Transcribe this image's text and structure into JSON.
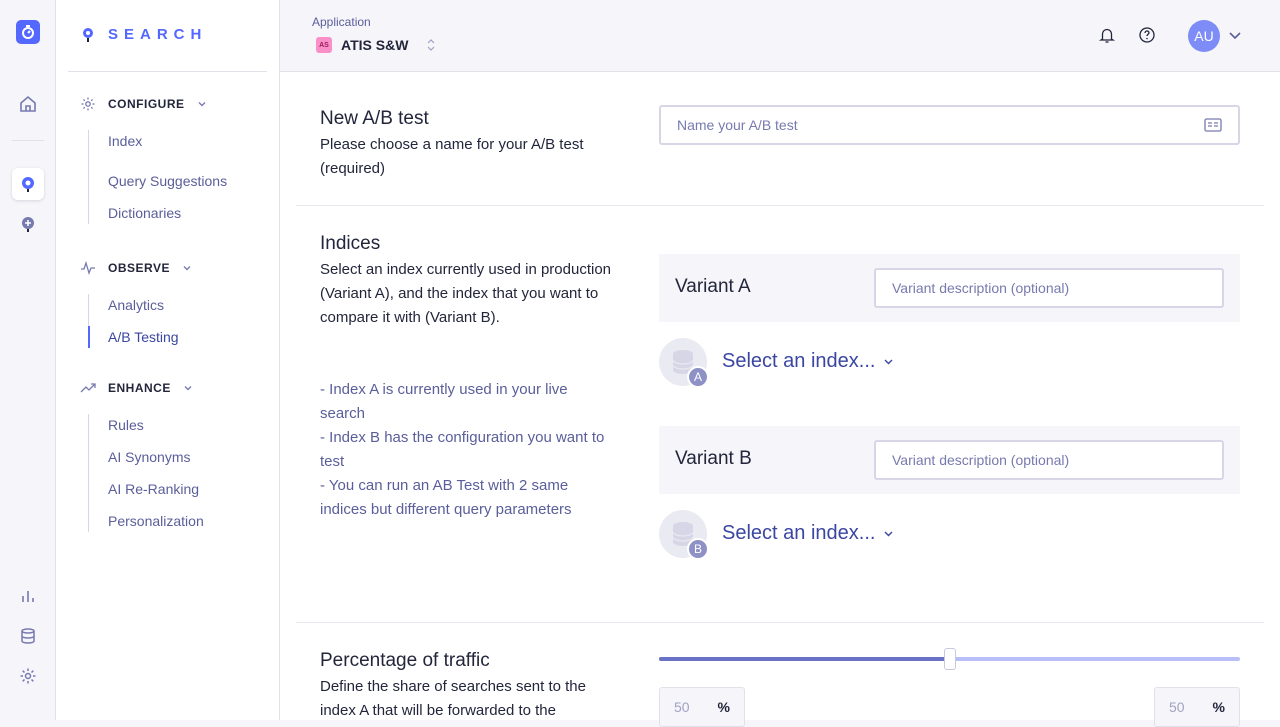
{
  "rail": {
    "items": [
      {
        "name": "algolia-logo-icon"
      },
      {
        "name": "home-icon"
      },
      {
        "name": "search-product-icon"
      },
      {
        "name": "recommend-product-icon"
      },
      {
        "name": "analytics-bars-icon"
      },
      {
        "name": "database-icon"
      },
      {
        "name": "settings-gear-icon"
      }
    ]
  },
  "sidebar": {
    "brand": "SEARCH",
    "sections": [
      {
        "label": "CONFIGURE",
        "items": [
          "Index",
          "Query Suggestions",
          "Dictionaries"
        ]
      },
      {
        "label": "OBSERVE",
        "items": [
          "Analytics",
          "A/B Testing"
        ]
      },
      {
        "label": "ENHANCE",
        "items": [
          "Rules",
          "AI Synonyms",
          "AI Re-Ranking",
          "Personalization"
        ]
      }
    ],
    "active_item": "A/B Testing"
  },
  "topbar": {
    "app_label": "Application",
    "app_badge": "AS",
    "app_name": "ATIS S&W",
    "avatar_initials": "AU"
  },
  "new_test": {
    "title": "New A/B test",
    "description": "Please choose a name for your A/B test (required)",
    "name_placeholder": "Name your A/B test"
  },
  "indices": {
    "title": "Indices",
    "description": "Select an index currently used in production (Variant A), and the index that you want to compare it with (Variant B).",
    "notes": [
      "- Index A is currently used in your live search",
      "- Index B has the configuration you want to test",
      "- You can run an AB Test with 2 same indices but different query parameters"
    ],
    "variant_a": {
      "label": "Variant A",
      "desc_placeholder": "Variant description (optional)",
      "select_label": "Select an index...",
      "letter": "A"
    },
    "variant_b": {
      "label": "Variant B",
      "desc_placeholder": "Variant description (optional)",
      "select_label": "Select an index...",
      "letter": "B"
    }
  },
  "traffic": {
    "title": "Percentage of traffic",
    "description": "Define the share of searches sent to the index A that will be forwarded to the",
    "split_a": 50,
    "split_b": 50,
    "a_value": "50",
    "b_value": "50",
    "unit": "%"
  }
}
